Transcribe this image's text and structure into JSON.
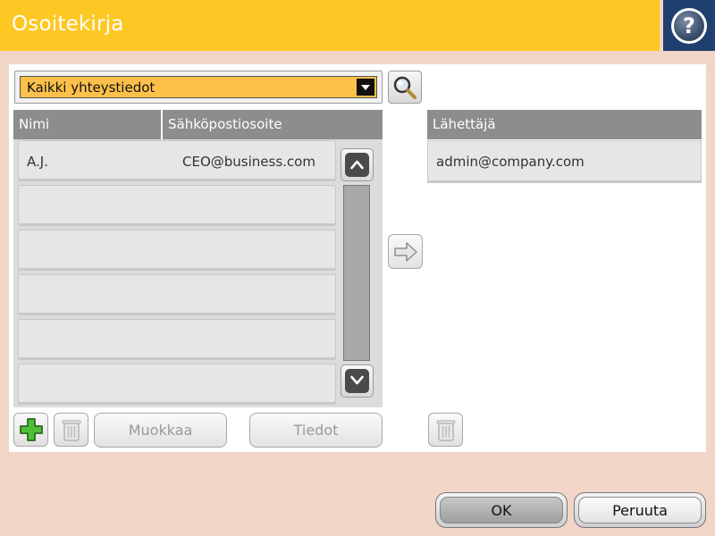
{
  "window": {
    "title": "Osoitekirja",
    "help_icon": "question-mark-icon",
    "help_glyph": "?"
  },
  "filter": {
    "selected": "Kaikki yhteystiedot",
    "search_icon": "magnifier-icon"
  },
  "contacts": {
    "columns": [
      "Nimi",
      "Sähköpostiosoite"
    ],
    "rows": [
      {
        "name": "A.J.",
        "email": "CEO@business.com"
      },
      {
        "name": "",
        "email": ""
      },
      {
        "name": "",
        "email": ""
      },
      {
        "name": "",
        "email": ""
      },
      {
        "name": "",
        "email": ""
      },
      {
        "name": "",
        "email": ""
      }
    ]
  },
  "sender": {
    "header": "Lähettäjä",
    "rows": [
      {
        "email": "admin@company.com"
      }
    ]
  },
  "toolbar": {
    "add_icon": "plus-icon",
    "delete_icon": "trash-icon",
    "edit_label": "Muokkaa",
    "info_label": "Tiedot"
  },
  "footer": {
    "ok_label": "OK",
    "cancel_label": "Peruuta"
  },
  "colors": {
    "title_bar": "#fdc823",
    "help_box": "#1f3f6e",
    "background": "#f1d6c8",
    "header_gray": "#8d8d8d",
    "dropdown_field": "#fdc04a"
  }
}
